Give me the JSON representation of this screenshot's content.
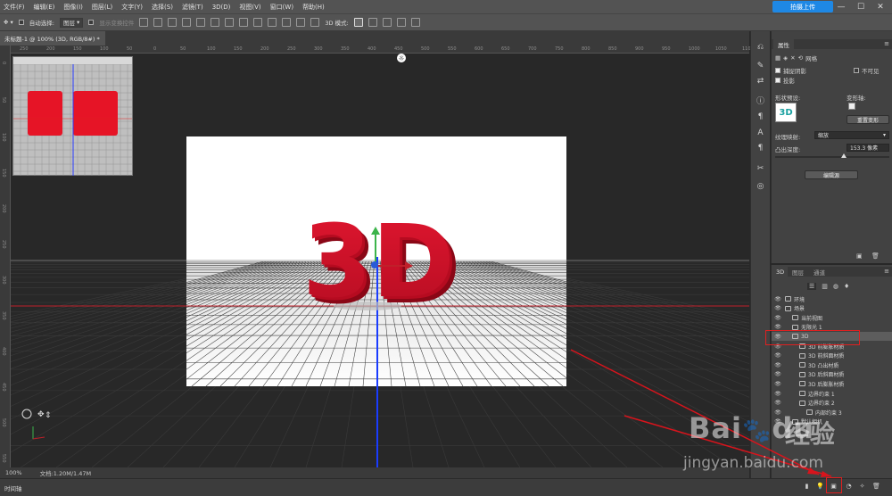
{
  "menu": [
    "文件(F)",
    "编辑(E)",
    "图像(I)",
    "图层(L)",
    "文字(Y)",
    "选择(S)",
    "滤镜(T)",
    "3D(D)",
    "视图(V)",
    "窗口(W)",
    "帮助(H)"
  ],
  "cloud_button": "拍摄上传",
  "options": {
    "auto_select_label": "自动选择:",
    "auto_select_value": "图层",
    "transform_controls": "显示变换控件",
    "mode_3d_label": "3D 模式:"
  },
  "document_tab": "未标题-1 @ 100% (3D, RGB/8#) *",
  "status": {
    "zoom": "100%",
    "doc_size": "文档:1.20M/1.47M"
  },
  "timeline_label": "时间轴",
  "canvas_text": "3D",
  "ruler_h": [
    "250",
    "200",
    "150",
    "100",
    "50",
    "0",
    "50",
    "100",
    "150",
    "200",
    "250",
    "300",
    "350",
    "400",
    "450",
    "500",
    "550",
    "600",
    "650",
    "700",
    "750",
    "800",
    "850",
    "900",
    "950",
    "1000",
    "1050",
    "1100"
  ],
  "ruler_v": [
    "0",
    "50",
    "100",
    "150",
    "200",
    "250",
    "300",
    "350",
    "400",
    "450",
    "500",
    "550"
  ],
  "properties": {
    "title": "属性",
    "tab": "网格",
    "capture_shadows": "捕捉阴影",
    "invisible": "不可见",
    "cast_shadows": "投影",
    "shape_preset": "形状预设:",
    "deform_axis": "变形轴:",
    "reset_deform": "重置变形",
    "texture_mapping_label": "纹理映射:",
    "texture_mapping_value": "缩放",
    "extrusion_depth_label": "凸出深度:",
    "extrusion_depth_value": "153.3 像素",
    "extrusion_depth_percent": 0.6,
    "edit_source": "编辑源",
    "preview_label": "3D"
  },
  "panel3d": {
    "tabs": [
      "3D",
      "图层",
      "通道"
    ],
    "items": [
      {
        "label": "环境",
        "indent": 0
      },
      {
        "label": "场景",
        "indent": 0
      },
      {
        "label": "当前视图",
        "indent": 1
      },
      {
        "label": "无限光 1",
        "indent": 1
      },
      {
        "label": "3D",
        "indent": 1,
        "selected": true
      },
      {
        "label": "3D 前膨胀材质",
        "indent": 2
      },
      {
        "label": "3D 前斜面材质",
        "indent": 2
      },
      {
        "label": "3D 凸出材质",
        "indent": 2
      },
      {
        "label": "3D 后斜面材质",
        "indent": 2
      },
      {
        "label": "3D 后膨胀材质",
        "indent": 2
      },
      {
        "label": "边界约束 1",
        "indent": 2
      },
      {
        "label": "边界约束 2",
        "indent": 2
      },
      {
        "label": "内部约束 3",
        "indent": 3
      },
      {
        "label": "默认相机",
        "indent": 1
      }
    ]
  },
  "watermark": {
    "logo": "Bai",
    "logo2": "du",
    "brand": "经验",
    "url": "jingyan.baidu.com"
  },
  "colors": {
    "accent": "#1e88e5",
    "highlight": "#e02020",
    "text3d": "#d8112a"
  }
}
